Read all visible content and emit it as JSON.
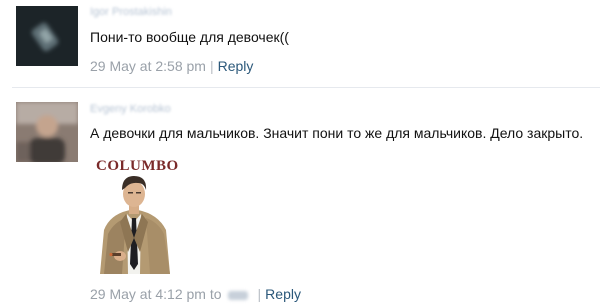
{
  "comments": [
    {
      "author": "Igor Prostakishin",
      "text": "Пони-то вообще для девочек((",
      "timestamp": "29 May at 2:58 pm",
      "reply_label": "Reply",
      "avatar": "blurred-dark-avatar"
    },
    {
      "author": "Evgeny Korobko",
      "text": "А девочки для мальчиков. Значит пони то же для мальчиков. Дело закрыто.",
      "timestamp": "29 May at 4:12 pm to",
      "reply_label": "Reply",
      "avatar": "blurred-man-avatar",
      "attachment": {
        "title": "COLUMBO",
        "type": "sticker-image"
      }
    }
  ],
  "colors": {
    "link": "#2b587a",
    "meta": "#9aa1a9",
    "text": "#111111"
  }
}
